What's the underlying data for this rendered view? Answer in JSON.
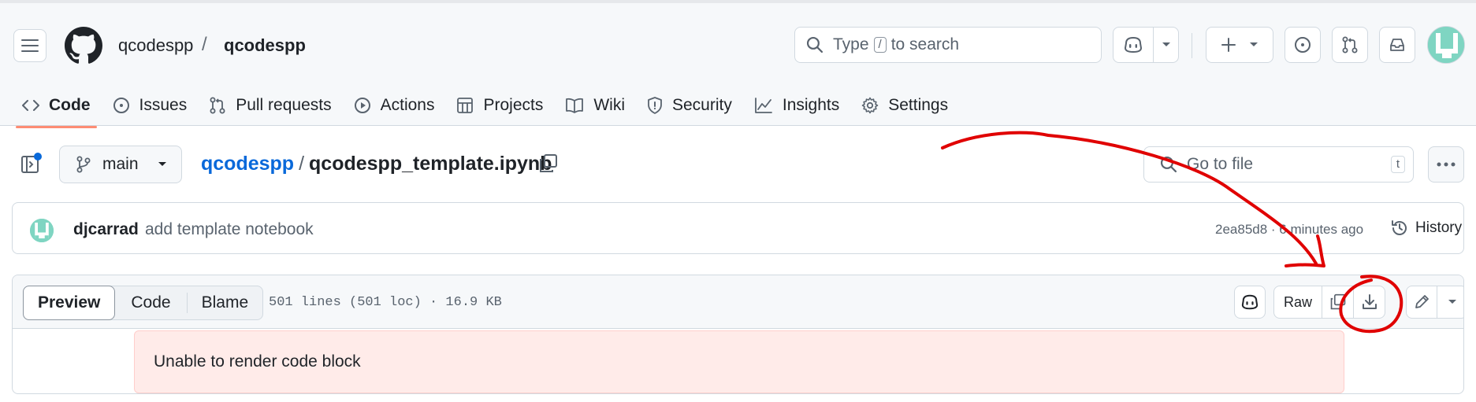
{
  "header": {
    "owner": "qcodespp",
    "separator": "/",
    "repo": "qcodespp",
    "search": {
      "prefix": "Type",
      "key": "/",
      "suffix": "to search"
    }
  },
  "repo_nav": {
    "tabs": [
      {
        "label": "Code",
        "icon": "code-icon",
        "active": true
      },
      {
        "label": "Issues",
        "icon": "issue-icon"
      },
      {
        "label": "Pull requests",
        "icon": "pull-request-icon"
      },
      {
        "label": "Actions",
        "icon": "play-icon"
      },
      {
        "label": "Projects",
        "icon": "table-icon"
      },
      {
        "label": "Wiki",
        "icon": "book-icon"
      },
      {
        "label": "Security",
        "icon": "shield-icon"
      },
      {
        "label": "Insights",
        "icon": "graph-icon"
      },
      {
        "label": "Settings",
        "icon": "gear-icon"
      }
    ]
  },
  "file_header": {
    "branch": "main",
    "path_repo": "qcodespp",
    "path_sep": "/",
    "file_name": "qcodespp_template.ipynb",
    "go_to_file_placeholder": "Go to file",
    "go_to_file_key": "t"
  },
  "commit": {
    "author": "djcarrad",
    "message": "add template notebook",
    "sha_time": "2ea85d8 · 6 minutes ago",
    "history_label": "History"
  },
  "viewer": {
    "tabs": {
      "preview": "Preview",
      "code": "Code",
      "blame": "Blame"
    },
    "file_info": "501 lines (501 loc) · 16.9 KB",
    "raw_label": "Raw",
    "error_message": "Unable to render code block"
  },
  "colors": {
    "accent_underline": "#fd8c73",
    "link": "#0969da",
    "annotation_red": "#e00000",
    "error_bg": "#ffebe9"
  }
}
